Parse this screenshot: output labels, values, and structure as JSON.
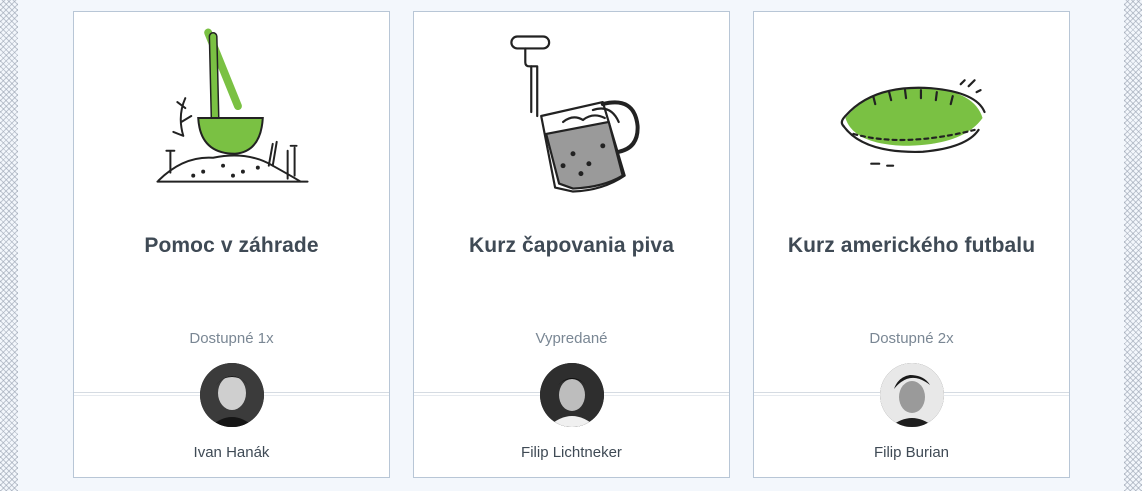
{
  "cards": [
    {
      "title": "Pomoc v záhrade",
      "availability": "Dostupné 1x",
      "author": "Ivan Hanák",
      "illustration": "garden-shovel-icon"
    },
    {
      "title": "Kurz čapovania piva",
      "availability": "Vypredané",
      "author": "Filip Lichtneker",
      "illustration": "beer-mug-tap-icon"
    },
    {
      "title": "Kurz amerického futbalu",
      "availability": "Dostupné 2x",
      "author": "Filip Burian",
      "illustration": "american-football-icon"
    }
  ],
  "colors": {
    "accent": "#7ac143",
    "card_border": "#b8c6d6",
    "text_dark": "#3f4a55",
    "text_muted": "#7a8794",
    "background": "#f3f7fc"
  }
}
